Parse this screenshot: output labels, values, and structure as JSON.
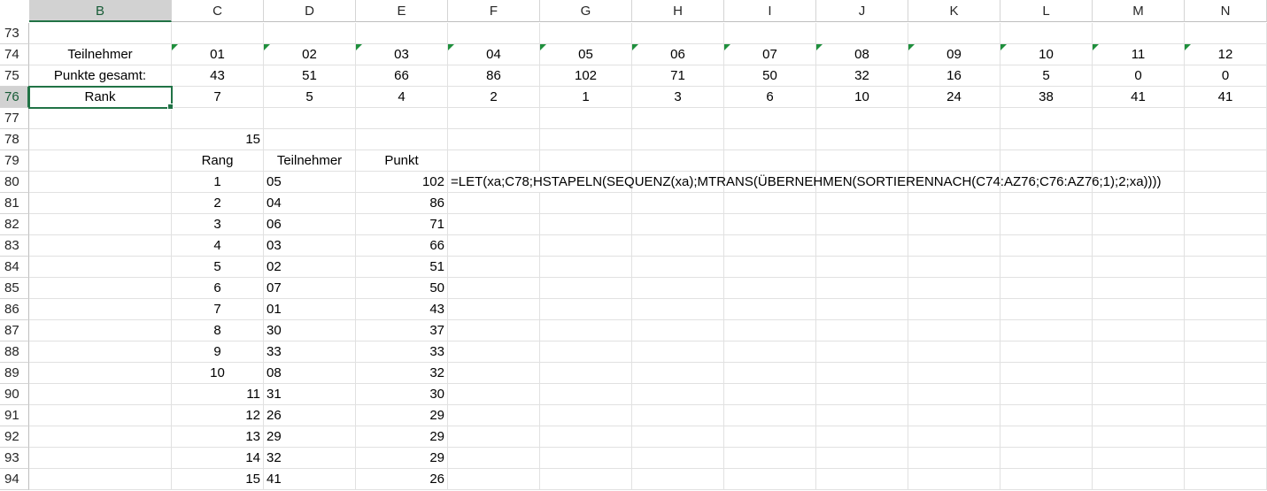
{
  "columns": [
    "B",
    "C",
    "D",
    "E",
    "F",
    "G",
    "H",
    "I",
    "J",
    "K",
    "L",
    "M",
    "N"
  ],
  "selected_column": "B",
  "selected_row": "76",
  "rows": [
    {
      "num": "73",
      "cells": {}
    },
    {
      "num": "74",
      "cells": {
        "B": "Teilnehmer",
        "C": "01",
        "D": "02",
        "E": "03",
        "F": "04",
        "G": "05",
        "H": "06",
        "I": "07",
        "J": "08",
        "K": "09",
        "L": "10",
        "M": "11",
        "N": "12"
      }
    },
    {
      "num": "75",
      "cells": {
        "B": "Punkte gesamt:",
        "C": "43",
        "D": "51",
        "E": "66",
        "F": "86",
        "G": "102",
        "H": "71",
        "I": "50",
        "J": "32",
        "K": "16",
        "L": "5",
        "M": "0",
        "N": "0"
      }
    },
    {
      "num": "76",
      "cells": {
        "B": "Rank",
        "C": "7",
        "D": "5",
        "E": "4",
        "F": "2",
        "G": "1",
        "H": "3",
        "I": "6",
        "J": "10",
        "K": "24",
        "L": "38",
        "M": "41",
        "N": "41"
      }
    },
    {
      "num": "77",
      "cells": {}
    },
    {
      "num": "78",
      "cells": {
        "C": "15"
      }
    },
    {
      "num": "79",
      "cells": {
        "C": "Rang",
        "D": "Teilnehmer",
        "E": "Punkt"
      }
    },
    {
      "num": "80",
      "cells": {
        "C": "1",
        "D": "05",
        "E": "102",
        "F": "=LET(xa;C78;HSTAPELN(SEQUENZ(xa);MTRANS(ÜBERNEHMEN(SORTIERENNACH(C74:AZ76;C76:AZ76;1);2;xa))))"
      }
    },
    {
      "num": "81",
      "cells": {
        "C": "2",
        "D": "04",
        "E": "86"
      }
    },
    {
      "num": "82",
      "cells": {
        "C": "3",
        "D": "06",
        "E": "71"
      }
    },
    {
      "num": "83",
      "cells": {
        "C": "4",
        "D": "03",
        "E": "66"
      }
    },
    {
      "num": "84",
      "cells": {
        "C": "5",
        "D": "02",
        "E": "51"
      }
    },
    {
      "num": "85",
      "cells": {
        "C": "6",
        "D": "07",
        "E": "50"
      }
    },
    {
      "num": "86",
      "cells": {
        "C": "7",
        "D": "01",
        "E": "43"
      }
    },
    {
      "num": "87",
      "cells": {
        "C": "8",
        "D": "30",
        "E": "37"
      }
    },
    {
      "num": "88",
      "cells": {
        "C": "9",
        "D": "33",
        "E": "33"
      }
    },
    {
      "num": "89",
      "cells": {
        "C": "10",
        "D": "08",
        "E": "32"
      }
    },
    {
      "num": "90",
      "cells": {
        "C": "11",
        "D": "31",
        "E": "30"
      }
    },
    {
      "num": "91",
      "cells": {
        "C": "12",
        "D": "26",
        "E": "29"
      }
    },
    {
      "num": "92",
      "cells": {
        "C": "13",
        "D": "29",
        "E": "29"
      }
    },
    {
      "num": "93",
      "cells": {
        "C": "14",
        "D": "32",
        "E": "29"
      }
    },
    {
      "num": "94",
      "cells": {
        "C": "15",
        "D": "41",
        "E": "26"
      }
    }
  ],
  "colors": {
    "accent": "#217346",
    "header_selected": "#d2d2d2",
    "error_triangle": "#1e8f3c"
  }
}
